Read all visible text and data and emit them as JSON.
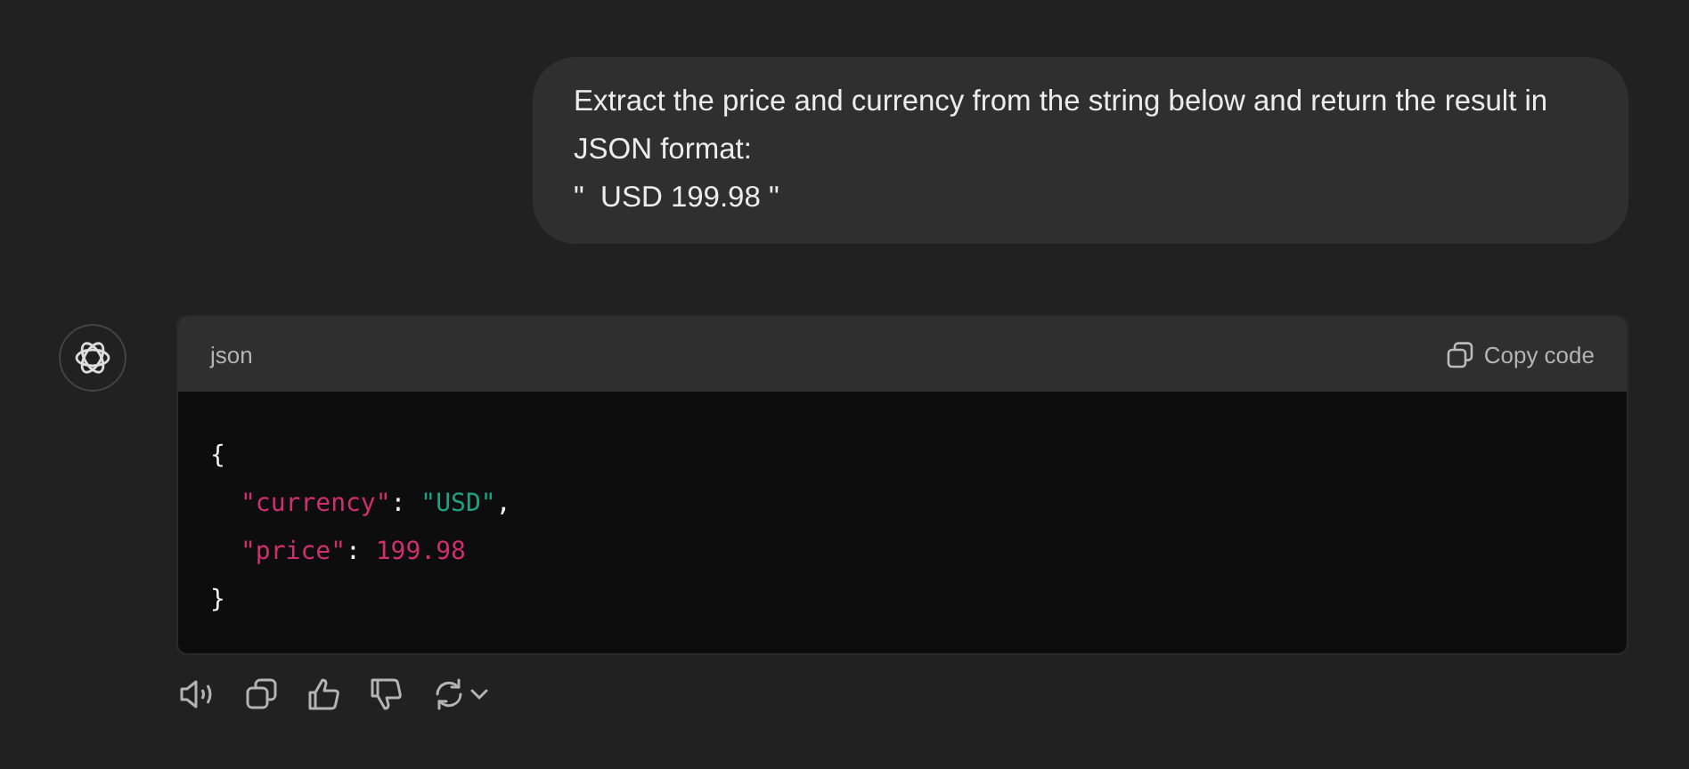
{
  "user_message": {
    "lines": [
      "Extract the price and currency from the string below and return the result in JSON format:",
      "\"  USD 199.98 \""
    ]
  },
  "code_block": {
    "language": "json",
    "copy_label": "Copy code",
    "lines": [
      [
        {
          "kind": "punct",
          "text": "{"
        }
      ],
      [
        {
          "kind": "key",
          "text": "\"currency\""
        },
        {
          "kind": "punct",
          "text": ": "
        },
        {
          "kind": "string",
          "text": "\"USD\""
        },
        {
          "kind": "punct",
          "text": ","
        }
      ],
      [
        {
          "kind": "key",
          "text": "\"price\""
        },
        {
          "kind": "punct",
          "text": ": "
        },
        {
          "kind": "number",
          "text": "199.98"
        }
      ],
      [
        {
          "kind": "punct",
          "text": "}"
        }
      ]
    ]
  }
}
